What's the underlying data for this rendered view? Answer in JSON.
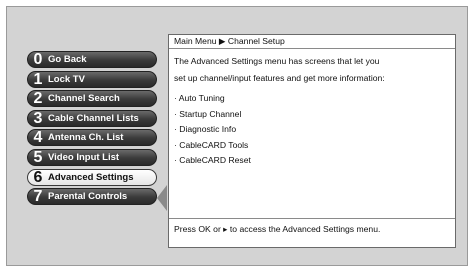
{
  "menu": {
    "items": [
      {
        "num": "0",
        "label": "Go Back"
      },
      {
        "num": "1",
        "label": "Lock TV"
      },
      {
        "num": "2",
        "label": "Channel Search"
      },
      {
        "num": "3",
        "label": "Cable Channel Lists"
      },
      {
        "num": "4",
        "label": "Antenna Ch. List"
      },
      {
        "num": "5",
        "label": "Video Input List"
      },
      {
        "num": "6",
        "label": "Advanced Settings"
      },
      {
        "num": "7",
        "label": "Parental Controls"
      }
    ],
    "selected_index": 6
  },
  "panel": {
    "breadcrumb": "Main Menu ▶ Channel Setup",
    "description_line1": "The Advanced Settings menu has screens that let you",
    "description_line2": "set up channel/input features and get more information:",
    "features": [
      "· Auto Tuning",
      "· Startup Channel",
      "· Diagnostic Info",
      "· CableCARD Tools",
      "· CableCARD Reset"
    ],
    "footer": "Press OK or ▸ to access the Advanced Settings menu."
  }
}
